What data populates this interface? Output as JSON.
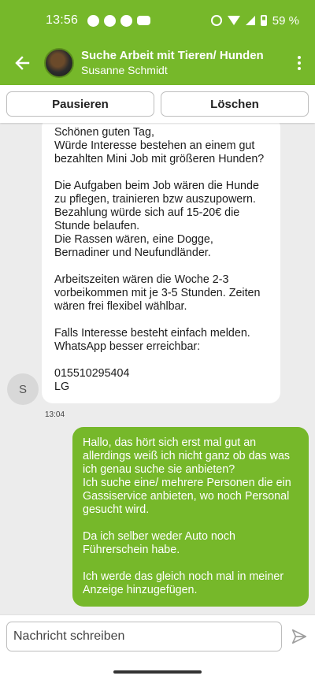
{
  "status_bar": {
    "time": "13:56",
    "battery": "59 %",
    "icons": [
      "pinterest-icon",
      "messenger-icon",
      "app-icon",
      "youtube-icon",
      "sync-icon",
      "wifi-icon",
      "signal-icon",
      "battery-icon"
    ]
  },
  "header": {
    "title": "Suche Arbeit mit Tieren/ Hunden",
    "subtitle": "Susanne Schmidt",
    "back_icon": "arrow-left-icon",
    "more_icon": "more-vertical-icon"
  },
  "actions": {
    "pause_label": "Pausieren",
    "delete_label": "Löschen"
  },
  "messages": {
    "incoming": {
      "sender_initial": "S",
      "time": "13:04",
      "paragraphs": [
        "Schönen guten Tag,\nWürde Interesse bestehen an einem gut bezahlten Mini Job mit größeren Hunden?",
        "Die Aufgaben beim Job wären die Hunde zu pflegen, trainieren bzw auszupowern. Bezahlung würde sich auf 15-20€ die Stunde belaufen.\nDie Rassen wären, eine Dogge,  Bernadiner und Neufundländer.",
        "Arbeitszeiten wären die Woche 2-3 vorbeikommen mit je 3-5 Stunden. Zeiten wären frei flexibel wählbar.",
        "Falls Interesse besteht einfach melden.\nWhatsApp besser erreichbar:",
        "015510295404\nLG"
      ]
    },
    "outgoing": {
      "paragraphs": [
        "Hallo, das hört sich erst mal gut an allerdings weiß ich nicht ganz ob das was ich genau suche sie anbieten?\nIch suche eine/ mehrere Personen die ein Gassiservice anbieten, wo noch Personal gesucht wird.",
        "Da ich selber weder Auto noch Führerschein habe.",
        "Ich werde das gleich noch mal in meiner Anzeige hinzugefügen."
      ]
    }
  },
  "composer": {
    "placeholder": "Nachricht schreiben",
    "send_icon": "send-icon"
  },
  "colors": {
    "brand_green": "#76b82a",
    "chat_background": "#ececec"
  }
}
